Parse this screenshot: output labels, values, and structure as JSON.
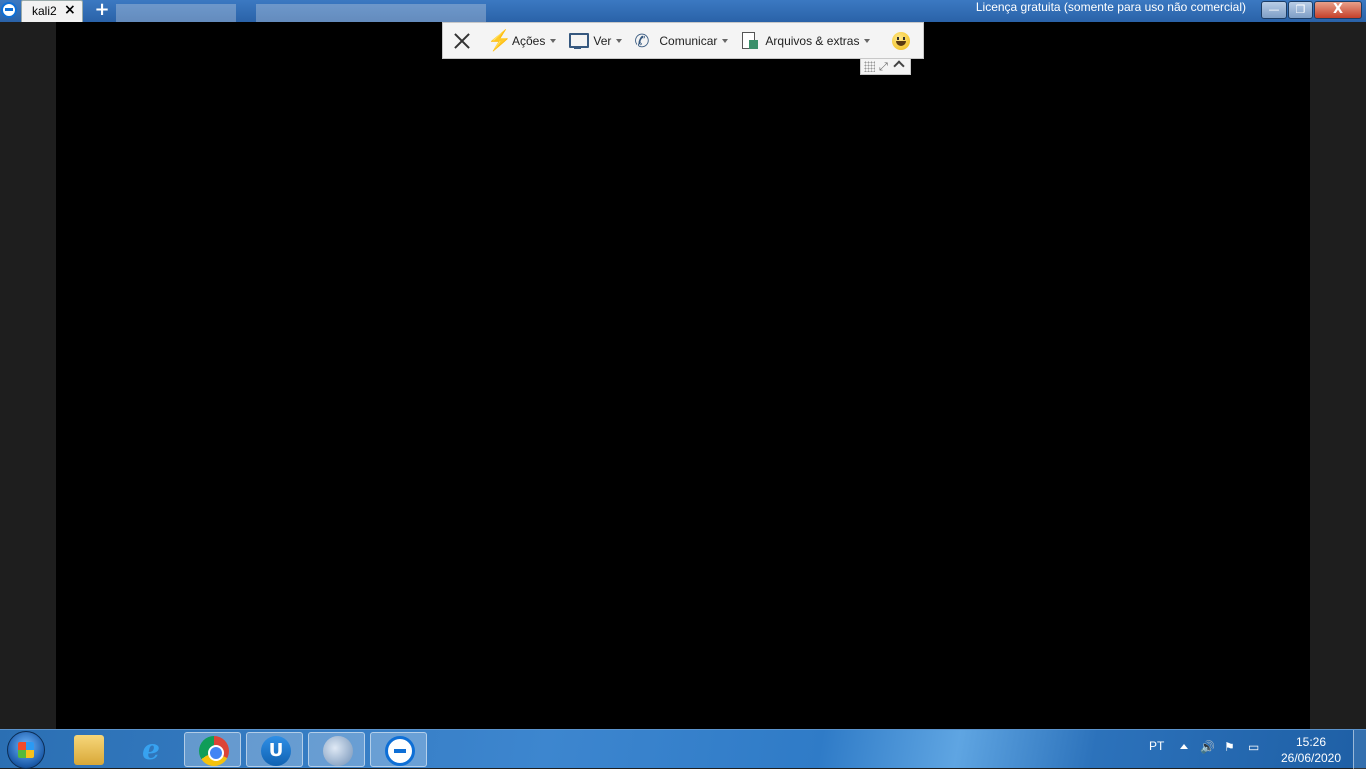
{
  "window": {
    "tab_label": "kali2",
    "tab_close_glyph": "×",
    "new_tab_glyph": "+",
    "license_text": "Licença gratuita (somente para uso não comercial)",
    "minimize_glyph": "—",
    "maximize_glyph": "❐",
    "close_glyph": "X"
  },
  "toolbar": {
    "items": [
      {
        "label": "Ações",
        "icon": "lightning-icon"
      },
      {
        "label": "Ver",
        "icon": "monitor-icon"
      },
      {
        "label": "Comunicar",
        "icon": "phone-chat-icon"
      },
      {
        "label": "Arquivos & extras",
        "icon": "files-icon"
      }
    ],
    "feedback_icon": "smiley-icon"
  },
  "subbar": {
    "expand_glyph": "⤢"
  },
  "taskbar": {
    "apps": [
      "windows-explorer-icon",
      "internet-explorer-icon",
      "chrome-icon",
      "ultrasurf-icon",
      "globe-app-icon",
      "teamviewer-icon"
    ],
    "ie_glyph": "e",
    "u_glyph": "U",
    "language": "PT",
    "time": "15:26",
    "date": "26/06/2020"
  },
  "colors": {
    "remote_background": "#000000",
    "taskbar_blue": "#2f7bc7",
    "teamviewer_blue": "#0e6fd6"
  }
}
